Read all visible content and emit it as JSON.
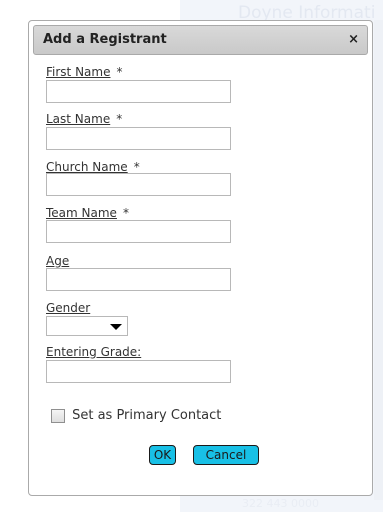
{
  "background": {
    "heading": "Doyne Informati",
    "footer_text": "322 443 0000"
  },
  "dialog": {
    "title": "Add a Registrant",
    "close_glyph": "×"
  },
  "fields": {
    "first_name": {
      "label": "First Name",
      "required_mark": "*",
      "value": ""
    },
    "last_name": {
      "label": "Last Name",
      "required_mark": "*",
      "value": ""
    },
    "church_name": {
      "label": "Church Name",
      "required_mark": "*",
      "value": ""
    },
    "team_name": {
      "label": "Team Name",
      "required_mark": "*",
      "value": ""
    },
    "age": {
      "label": "Age",
      "value": ""
    },
    "gender": {
      "label": "Gender",
      "selected": ""
    },
    "entering_grade": {
      "label": "Entering Grade:",
      "value": ""
    }
  },
  "primary_contact": {
    "label": "Set as Primary Contact",
    "checked": false
  },
  "buttons": {
    "ok": "OK",
    "cancel": "Cancel"
  },
  "colors": {
    "button_fill": "#18c0e6",
    "titlebar": "#d3d3d3"
  }
}
